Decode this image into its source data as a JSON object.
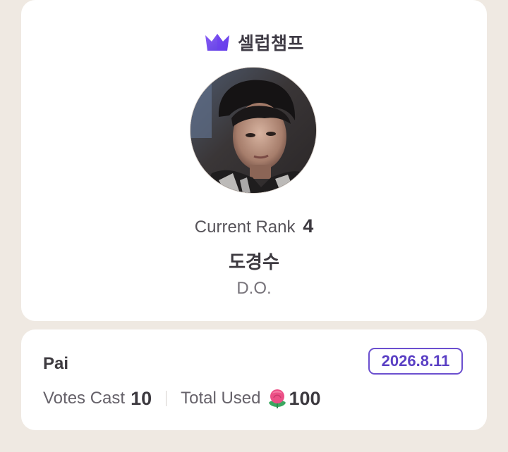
{
  "brand": {
    "name": "셀럽챔프",
    "logo_icon": "crown-icon"
  },
  "profile": {
    "rank_label": "Current Rank",
    "rank_value": "4",
    "name_korean": "도경수",
    "name_english": "D.O."
  },
  "vote": {
    "voter_name": "Pai",
    "date": "2026.8.11",
    "votes_cast_label": "Votes Cast",
    "votes_cast_value": "10",
    "total_used_label": "Total Used",
    "total_used_icon": "flower-icon",
    "total_used_value": "100"
  },
  "colors": {
    "background": "#efe9e2",
    "card": "#ffffff",
    "accent": "#5a3fc4",
    "text_dark": "#3c393f",
    "text_muted": "#66626a"
  }
}
